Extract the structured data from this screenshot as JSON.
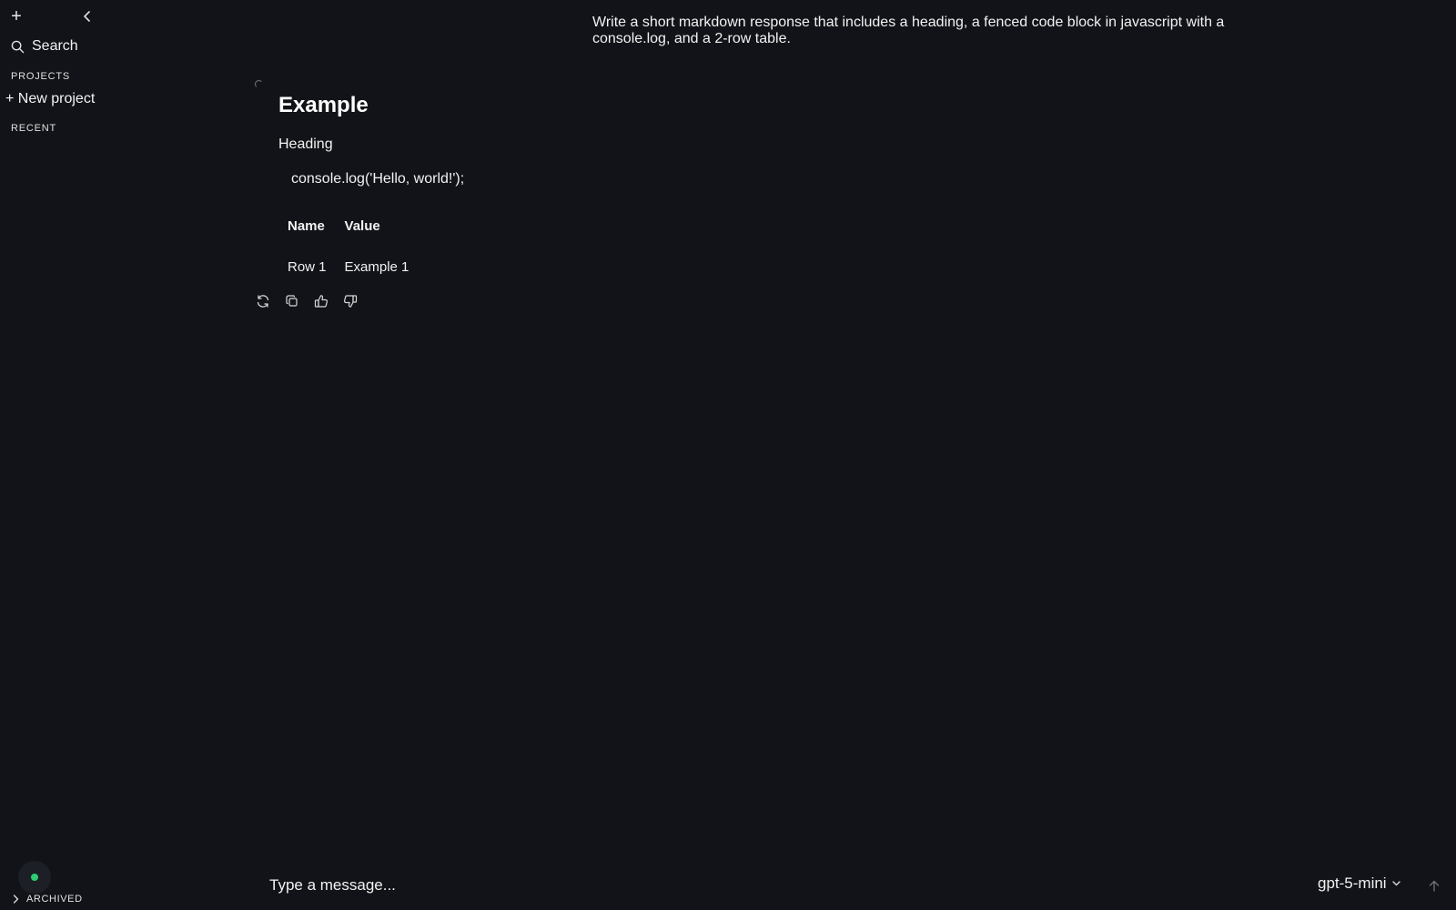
{
  "sidebar": {
    "new_chat_icon": "plus-icon",
    "collapse_icon": "chevron-left-icon",
    "search_label": "Search",
    "projects_label": "PROJECTS",
    "new_project_label": "+ New project",
    "recent_label": "RECENT",
    "status_color": "#2ecc71",
    "archived_label": "ARCHIVED"
  },
  "conversation": {
    "user_message": "Write a short markdown response that includes a heading, a fenced code block in javascript with a console.log, and a 2-row table.",
    "assistant": {
      "heading": "Example",
      "subheading": "Heading",
      "code": "console.log('Hello, world!');",
      "table": {
        "headers": [
          "Name",
          "Value"
        ],
        "rows": [
          [
            "Row 1",
            "Example 1"
          ]
        ]
      },
      "actions": [
        "refresh-icon",
        "copy-icon",
        "thumbs-up-icon",
        "thumbs-down-icon"
      ]
    }
  },
  "composer": {
    "placeholder": "Type a message...",
    "model": "gpt-5-mini",
    "send_icon": "arrow-up-icon"
  }
}
